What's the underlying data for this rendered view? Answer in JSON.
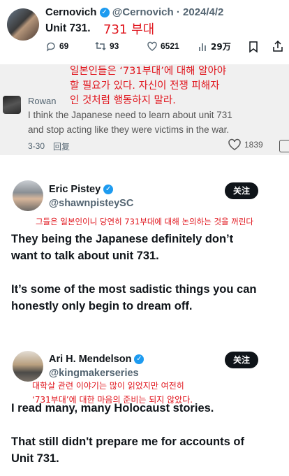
{
  "tweet1": {
    "name": "Cernovich",
    "handle_date": "@Cernovich · 2024/4/2",
    "text": "Unit 731.",
    "annotation": "731 부대",
    "stats": {
      "replies": "69",
      "retweets": "93",
      "likes": "6521",
      "views": "29万"
    }
  },
  "comment_block": {
    "annotation_lines": [
      "일본인들은 ‘731부대’에 대해 알아야",
      "할 필요가 있다. 자신이 전쟁 피해자",
      "인 것처럼 행동하지 말라."
    ],
    "user": "Rowan",
    "text_lines": [
      "I think the Japanese need to learn about unit 731",
      "and stop acting like they were victims in the war."
    ],
    "date": "3-30",
    "reply": "回复",
    "likes": "1839"
  },
  "tweet2": {
    "name": "Eric Pistey",
    "handle": "@shawnpisteySC",
    "follow_label": "关注",
    "annotation": "그들은 일본인이니 당연히 731부대에 대해 논의하는 것을 꺼린다",
    "text_lines": [
      "They being the Japanese definitely don’t",
      "want to talk about unit 731.",
      "",
      "It’s some of the most sadistic things you can",
      "honestly only begin to dream off."
    ]
  },
  "tweet3": {
    "name": "Ari H. Mendelson",
    "handle": "@kingmakerseries",
    "follow_label": "关注",
    "annotation_lines": [
      "대학살 관련 이야기는 많이 읽었지만 여전히",
      "‘731부대’에 대한 마음의 준비는 되지 않았다."
    ],
    "text_lines": [
      "I read many, many Holocaust stories.",
      "",
      "That still didn't prepare me for accounts of",
      "Unit 731."
    ]
  }
}
